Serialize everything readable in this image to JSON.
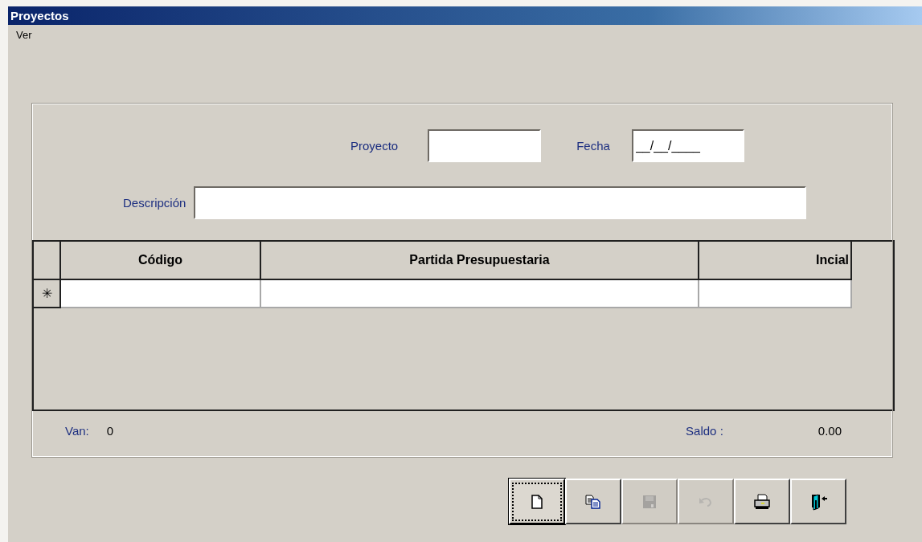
{
  "window": {
    "title": "Proyectos"
  },
  "menu": [
    "Ver"
  ],
  "form": {
    "proyecto": {
      "label": "Proyecto"
    },
    "fecha": {
      "label": "Fecha",
      "value": "__/__/____"
    },
    "descripcion": {
      "label": "Descripción"
    }
  },
  "table": {
    "columns": [
      "Código",
      "Partida Presupuestaria",
      "Incial"
    ],
    "new_row_marker": "✳"
  },
  "footer": {
    "van_label": "Van:",
    "van_value": "0",
    "saldo_label": "Saldo :",
    "saldo_value": "0.00"
  },
  "toolbar": [
    {
      "kind": "new",
      "disabled": false,
      "focused": true
    },
    {
      "kind": "copy",
      "disabled": false,
      "focused": false
    },
    {
      "kind": "save",
      "disabled": true,
      "focused": false
    },
    {
      "kind": "undo",
      "disabled": true,
      "focused": false
    },
    {
      "kind": "print",
      "disabled": false,
      "focused": false
    },
    {
      "kind": "exit",
      "disabled": false,
      "focused": false
    }
  ]
}
